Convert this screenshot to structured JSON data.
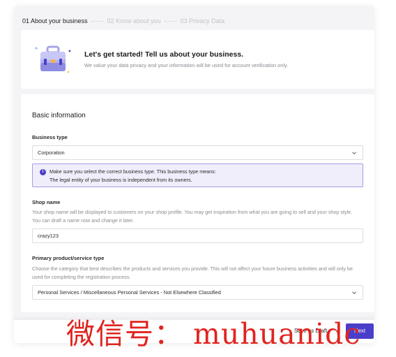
{
  "stepper": {
    "steps": [
      {
        "label": "01 About your business",
        "state": "active"
      },
      {
        "label": "02 Know about you",
        "state": "inactive"
      },
      {
        "label": "03 Privacy Data",
        "state": "inactive"
      }
    ]
  },
  "intro": {
    "title": "Let's get started! Tell us about your business.",
    "subtitle": "We value your data privacy and your information will be used for account verification only.",
    "illustration_icon": "briefcase-illustration"
  },
  "basic_info": {
    "section_title": "Basic information",
    "business_type": {
      "label": "Business type",
      "value": "Corporation"
    },
    "notice": {
      "line1": "Make sure you select the correct business type. This business type means:",
      "line2": "The legal entity of your business is independent from its owners."
    },
    "shop_name": {
      "label": "Shop name",
      "help": "Your shop name will be displayed to customers on your shop profile. You may get inspiration from what you are going to sell and your shop style. You can draft a name now and change it later.",
      "value": "crazy123"
    },
    "primary_type": {
      "label": "Primary product/service type",
      "help": "Choose the category that best describes the products and services you provide. This will not affect your future business activities and will only be used for completing the registration process.",
      "value": "Personal Services / Miscellaneous Personal Services - Not Elsewhere Classified"
    }
  },
  "footer": {
    "save_draft_label": "Save as Draft",
    "next_label": "Next"
  },
  "watermark": "微信号： muhuanidc",
  "colors": {
    "accent": "#4b3fc9",
    "notice_bg": "#f0eefa",
    "notice_border": "#a69be6",
    "watermark": "#e0241f"
  }
}
